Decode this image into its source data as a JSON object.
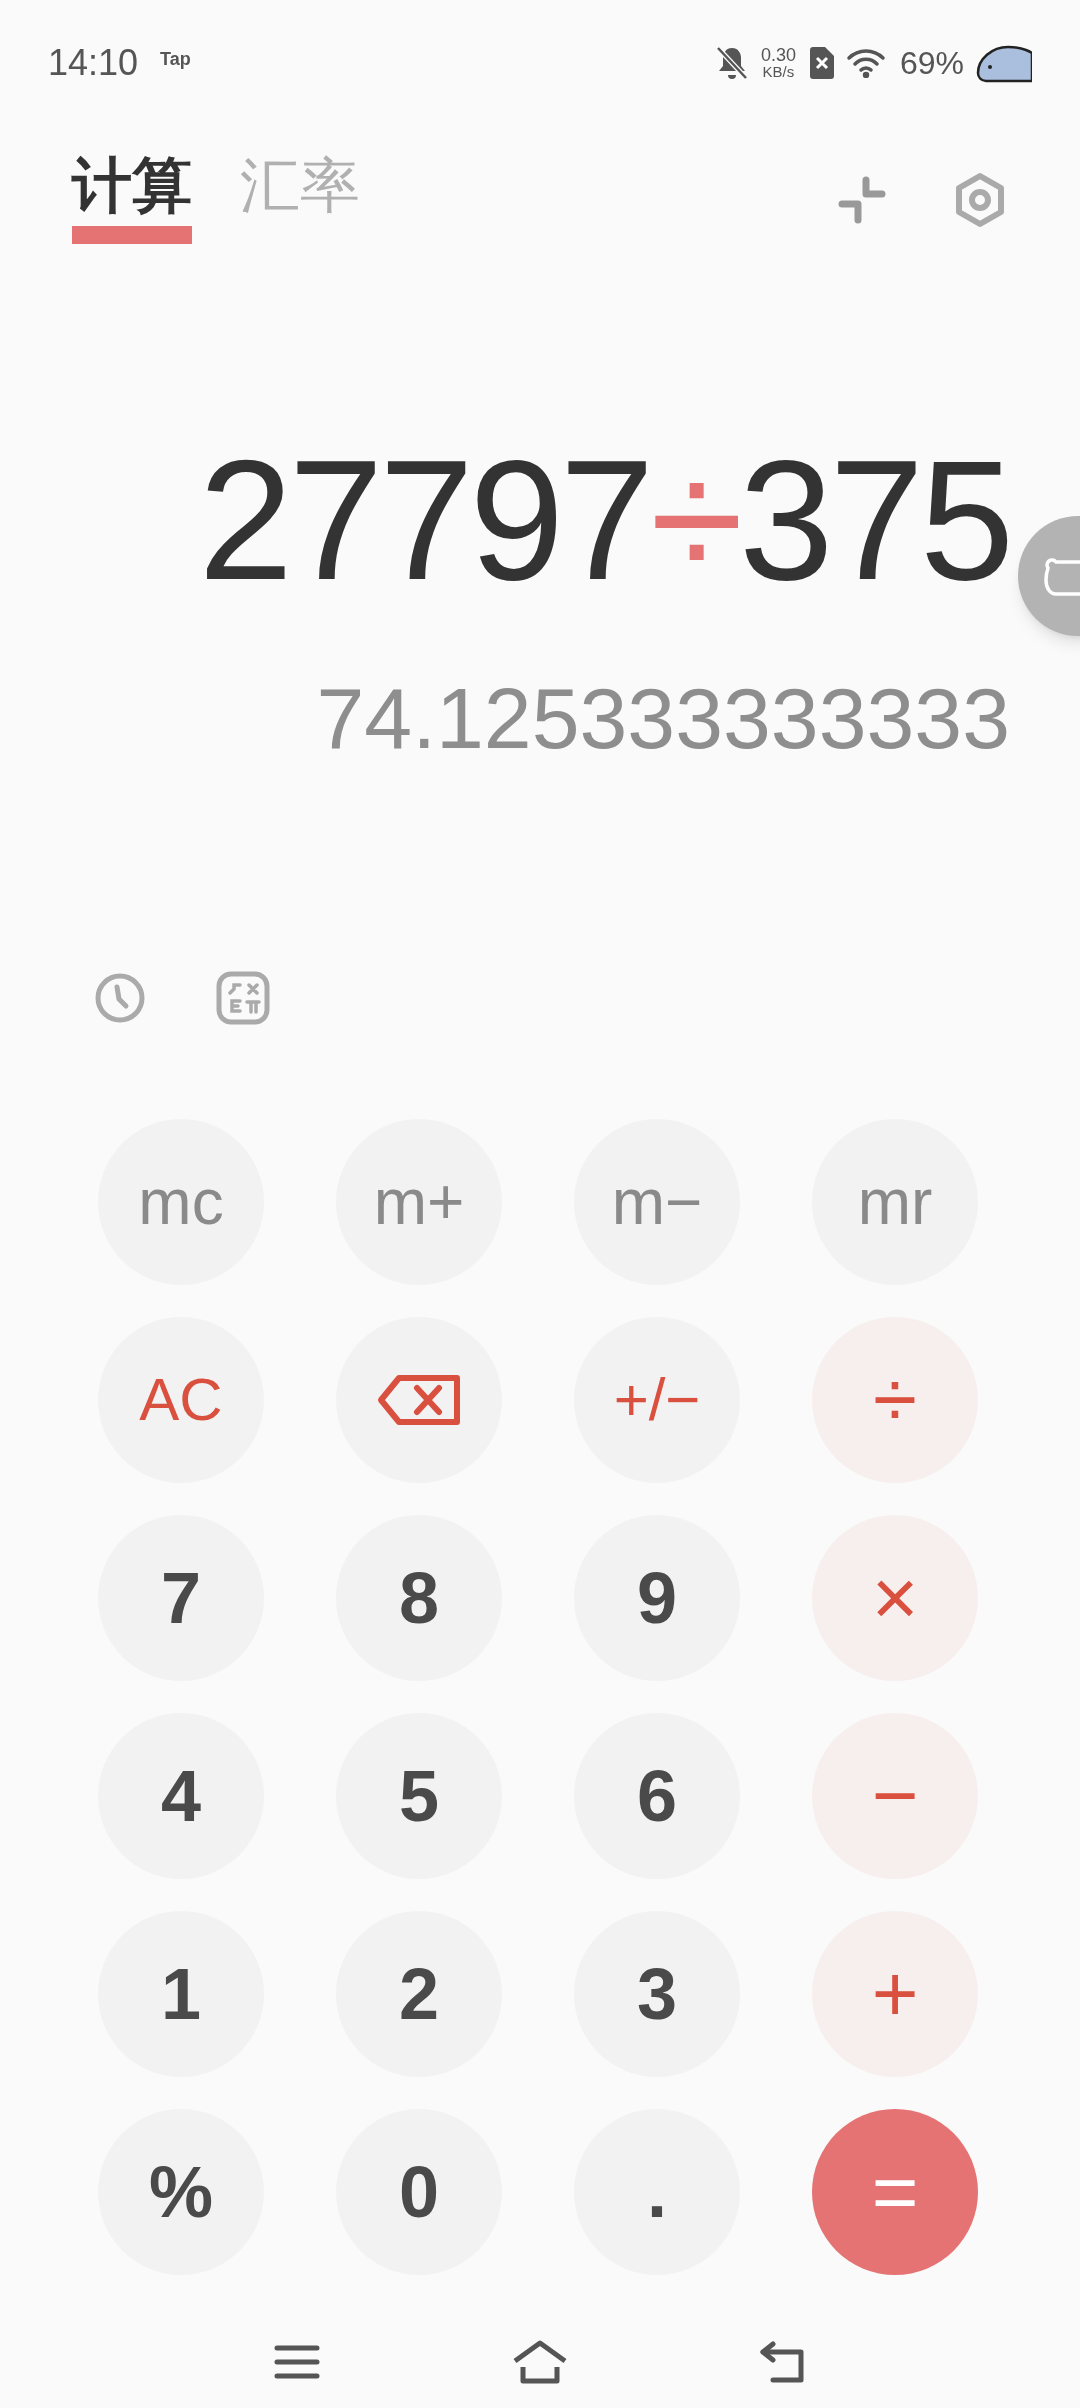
{
  "status_bar": {
    "time": "14:10",
    "carrier_note": "Tap",
    "speed_value": "0.30",
    "speed_unit": "KB/s",
    "battery": "69%"
  },
  "tabs": [
    {
      "label": "计算",
      "selected": true
    },
    {
      "label": "汇率",
      "selected": false
    }
  ],
  "display": {
    "expression": [
      {
        "text": "27797",
        "kind": "number"
      },
      {
        "text": "÷",
        "kind": "operator"
      },
      {
        "text": "375",
        "kind": "number"
      }
    ],
    "result": "74.125333333333"
  },
  "keys": [
    {
      "label": "mc",
      "kind": "memory"
    },
    {
      "label": "m+",
      "kind": "memory"
    },
    {
      "label": "m−",
      "kind": "memory"
    },
    {
      "label": "mr",
      "kind": "memory"
    },
    {
      "label": "AC",
      "kind": "function"
    },
    {
      "kind": "backspace"
    },
    {
      "label": "+/−",
      "kind": "function"
    },
    {
      "label": "÷",
      "kind": "operator"
    },
    {
      "label": "7",
      "kind": "digit"
    },
    {
      "label": "8",
      "kind": "digit"
    },
    {
      "label": "9",
      "kind": "digit"
    },
    {
      "label": "×",
      "kind": "operator"
    },
    {
      "label": "4",
      "kind": "digit"
    },
    {
      "label": "5",
      "kind": "digit"
    },
    {
      "label": "6",
      "kind": "digit"
    },
    {
      "label": "−",
      "kind": "operator"
    },
    {
      "label": "1",
      "kind": "digit"
    },
    {
      "label": "2",
      "kind": "digit"
    },
    {
      "label": "3",
      "kind": "digit"
    },
    {
      "label": "+",
      "kind": "operator"
    },
    {
      "label": "%",
      "kind": "digit"
    },
    {
      "label": "0",
      "kind": "digit"
    },
    {
      "label": ".",
      "kind": "digit"
    },
    {
      "label": "=",
      "kind": "equals"
    }
  ]
}
